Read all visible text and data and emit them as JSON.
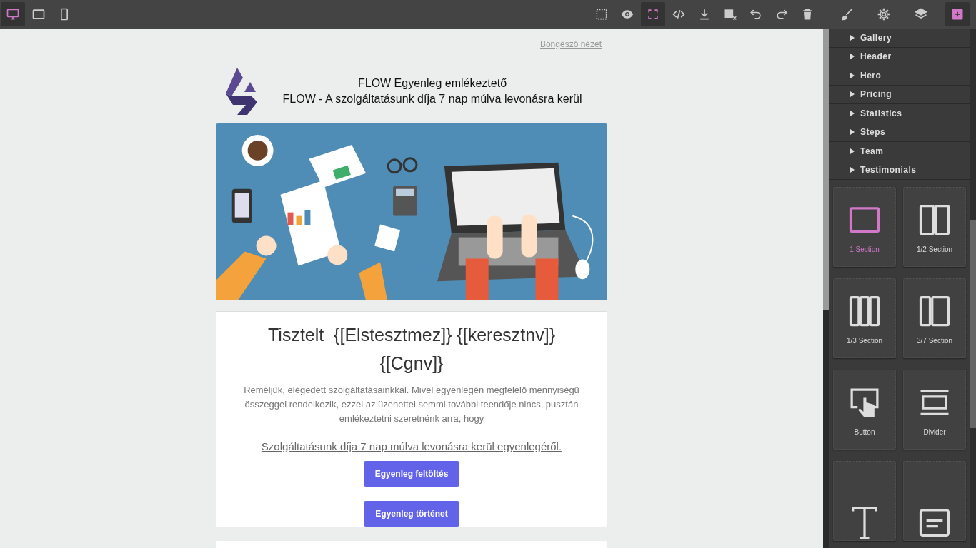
{
  "toolbar": {
    "devices": [
      {
        "selected": true
      },
      {
        "selected": false
      },
      {
        "selected": false
      }
    ],
    "actions": [
      {
        "selected": false
      },
      {
        "selected": false
      },
      {
        "selected": true
      },
      {
        "selected": false
      },
      {
        "selected": false
      },
      {
        "selected": false
      },
      {
        "selected": false
      },
      {
        "selected": false
      },
      {
        "selected": false
      }
    ]
  },
  "panel_tabs": [
    {
      "selected": false
    },
    {
      "selected": false
    },
    {
      "selected": false
    },
    {
      "selected": true
    }
  ],
  "email": {
    "browser_link": "Böngésző nézet",
    "header_lines": [
      "FLOW Egyenleg emlékeztető",
      "FLOW - A szolgáltatásunk díja 7 nap múlva levonásra kerül"
    ],
    "heading": "Tisztelt  {[Elstesztmez]} {[keresztnv]} {[Cgnv]}",
    "paragraph": "Reméljük, elégedett szolgáltatásainkkal. Mivel egyenlegén megfelelő mennyiségű összeggel rendelkezik, ezzel az üzenettel semmi további teendője nincs, pusztán emlékeztetni szeretnénk arra, hogy",
    "link": "Szolgáltatásunk díja 7 nap múlva levonásra kerül egyenlegéről.",
    "buttons": [
      "Egyenleg feltöltés",
      "Egyenleg történet"
    ]
  },
  "categories": [
    {
      "label": "Gallery",
      "expanded": false
    },
    {
      "label": "Header",
      "expanded": false
    },
    {
      "label": "Hero",
      "expanded": false
    },
    {
      "label": "Pricing",
      "expanded": false
    },
    {
      "label": "Statistics",
      "expanded": false
    },
    {
      "label": "Steps",
      "expanded": false
    },
    {
      "label": "Team",
      "expanded": false
    },
    {
      "label": "Testimonials",
      "expanded": false
    }
  ],
  "blocks": [
    {
      "label": "1 Section",
      "selected": true
    },
    {
      "label": "1/2 Section",
      "selected": false
    },
    {
      "label": "1/3 Section",
      "selected": false
    },
    {
      "label": "3/7 Section",
      "selected": false
    },
    {
      "label": "Button",
      "selected": false
    },
    {
      "label": "Divider",
      "selected": false
    },
    {
      "selected": false
    },
    {
      "selected": false
    }
  ]
}
